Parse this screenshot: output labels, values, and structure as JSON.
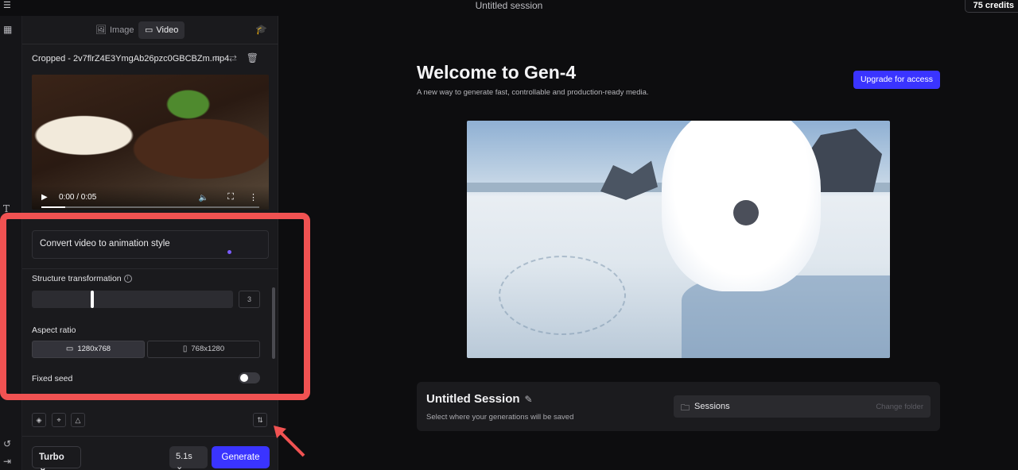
{
  "topbar": {
    "menu_icon": "hamburger-icon",
    "title": "Untitled session",
    "credits": "75 credits"
  },
  "rail": {
    "icons": [
      "grid-icon",
      "text-icon",
      "history-icon",
      "collapse-icon"
    ]
  },
  "sidebar": {
    "tabs": [
      {
        "label": "Image",
        "icon": "image-icon",
        "active": false
      },
      {
        "label": "Video",
        "icon": "video-icon",
        "active": true
      }
    ],
    "cap_icon": "graduation-cap-icon",
    "file_name": "Cropped - 2v7flrZ4E3YmgAb26pzc0GBCBZm.mp4",
    "file_actions": [
      "crop-icon",
      "swap-icon",
      "trash-icon"
    ],
    "video": {
      "time": "0:00 / 0:05",
      "progress": 0.11
    },
    "prompt": "Convert video to animation style",
    "structure": {
      "label": "Structure transformation",
      "value": "3",
      "fraction": 0.3
    },
    "aspect": {
      "label": "Aspect ratio",
      "options": [
        "1280x768",
        "768x1280"
      ],
      "selected": "1280x768"
    },
    "seed": {
      "label": "Fixed seed",
      "enabled": false
    },
    "tools": [
      "layers-icon",
      "focus-icon",
      "shapes-icon"
    ],
    "settings_icon": "sliders-icon",
    "mode": "Turbo",
    "duration": "5.1s",
    "generate": "Generate"
  },
  "main": {
    "title": "Welcome to Gen-4",
    "subtitle": "A new way to generate fast, controllable and production-ready media.",
    "upgrade": "Upgrade for access",
    "session": {
      "title": "Untitled Session",
      "subtitle": "Select where your generations will be saved",
      "sessions_label": "Sessions",
      "change_folder": "Change folder"
    }
  },
  "colors": {
    "accent": "#3a34ff",
    "highlight": "#f05252"
  }
}
